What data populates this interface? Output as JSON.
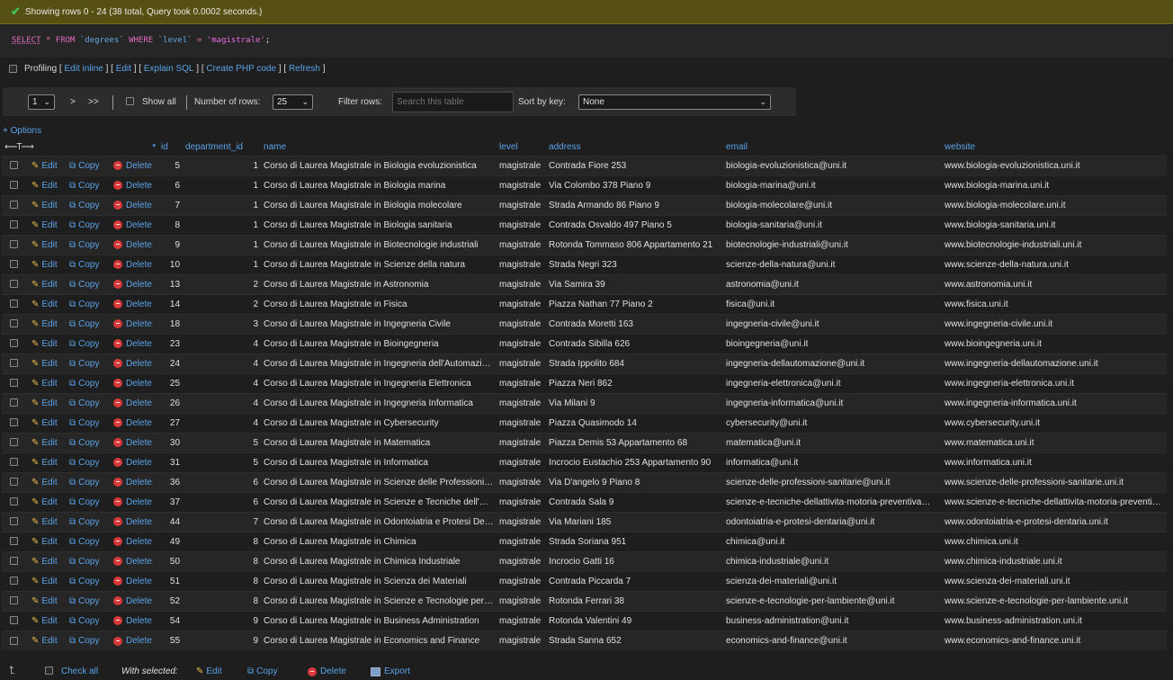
{
  "status": {
    "message": "Showing rows 0 - 24 (38 total, Query took 0.0002 seconds.)"
  },
  "query": {
    "select": "SELECT",
    "star": "*",
    "from": "FROM",
    "table": "`degrees`",
    "where": "WHERE",
    "column": "`level`",
    "eq": "=",
    "value": "'magistrale'",
    "semicolon": ";"
  },
  "query_links": {
    "profiling": "Profiling",
    "edit_inline": "Edit inline",
    "edit": "Edit",
    "explain": "Explain SQL",
    "php": "Create PHP code",
    "refresh": "Refresh"
  },
  "nav": {
    "page": "1",
    "next": ">",
    "last": ">>",
    "show_all": "Show all",
    "num_rows_label": "Number of rows:",
    "num_rows": "25",
    "filter_label": "Filter rows:",
    "filter_placeholder": "Search this table",
    "sort_label": "Sort by key:",
    "sort_value": "None"
  },
  "options_link": "+ Options",
  "columns": [
    "id",
    "department_id",
    "name",
    "level",
    "address",
    "email",
    "website"
  ],
  "actions": {
    "edit": "Edit",
    "copy": "Copy",
    "delete": "Delete"
  },
  "rows": [
    [
      "5",
      "1",
      "Corso di Laurea Magistrale in Biologia evoluzionistica",
      "magistrale",
      "Contrada Fiore 253",
      "biologia-evoluzionistica@uni.it",
      "www.biologia-evoluzionistica.uni.it"
    ],
    [
      "6",
      "1",
      "Corso di Laurea Magistrale in Biologia marina",
      "magistrale",
      "Via Colombo 378 Piano 9",
      "biologia-marina@uni.it",
      "www.biologia-marina.uni.it"
    ],
    [
      "7",
      "1",
      "Corso di Laurea Magistrale in Biologia molecolare",
      "magistrale",
      "Strada Armando 86 Piano 9",
      "biologia-molecolare@uni.it",
      "www.biologia-molecolare.uni.it"
    ],
    [
      "8",
      "1",
      "Corso di Laurea Magistrale in Biologia sanitaria",
      "magistrale",
      "Contrada Osvaldo 497 Piano 5",
      "biologia-sanitaria@uni.it",
      "www.biologia-sanitaria.uni.it"
    ],
    [
      "9",
      "1",
      "Corso di Laurea Magistrale in Biotecnologie industriali",
      "magistrale",
      "Rotonda Tommaso 806 Appartamento 21",
      "biotecnologie-industriali@uni.it",
      "www.biotecnologie-industriali.uni.it"
    ],
    [
      "10",
      "1",
      "Corso di Laurea Magistrale in Scienze della natura",
      "magistrale",
      "Strada Negri 323",
      "scienze-della-natura@uni.it",
      "www.scienze-della-natura.uni.it"
    ],
    [
      "13",
      "2",
      "Corso di Laurea Magistrale in Astronomia",
      "magistrale",
      "Via Samira 39",
      "astronomia@uni.it",
      "www.astronomia.uni.it"
    ],
    [
      "14",
      "2",
      "Corso di Laurea Magistrale in Fisica",
      "magistrale",
      "Piazza Nathan 77 Piano 2",
      "fisica@uni.it",
      "www.fisica.uni.it"
    ],
    [
      "18",
      "3",
      "Corso di Laurea Magistrale in Ingegneria Civile",
      "magistrale",
      "Contrada Moretti 163",
      "ingegneria-civile@uni.it",
      "www.ingegneria-civile.uni.it"
    ],
    [
      "23",
      "4",
      "Corso di Laurea Magistrale in Bioingegneria",
      "magistrale",
      "Contrada Sibilla 626",
      "bioingegneria@uni.it",
      "www.bioingegneria.uni.it"
    ],
    [
      "24",
      "4",
      "Corso di Laurea Magistrale in Ingegneria dell'Automazione",
      "magistrale",
      "Strada Ippolito 684",
      "ingegneria-dellautomazione@uni.it",
      "www.ingegneria-dellautomazione.uni.it"
    ],
    [
      "25",
      "4",
      "Corso di Laurea Magistrale in Ingegneria Elettronica",
      "magistrale",
      "Piazza Neri 862",
      "ingegneria-elettronica@uni.it",
      "www.ingegneria-elettronica.uni.it"
    ],
    [
      "26",
      "4",
      "Corso di Laurea Magistrale in Ingegneria Informatica",
      "magistrale",
      "Via Milani 9",
      "ingegneria-informatica@uni.it",
      "www.ingegneria-informatica.uni.it"
    ],
    [
      "27",
      "4",
      "Corso di Laurea Magistrale in Cybersecurity",
      "magistrale",
      "Piazza Quasimodo 14",
      "cybersecurity@uni.it",
      "www.cybersecurity.uni.it"
    ],
    [
      "30",
      "5",
      "Corso di Laurea Magistrale in Matematica",
      "magistrale",
      "Piazza Demis 53 Appartamento 68",
      "matematica@uni.it",
      "www.matematica.uni.it"
    ],
    [
      "31",
      "5",
      "Corso di Laurea Magistrale in Informatica",
      "magistrale",
      "Incrocio Eustachio 253 Appartamento 90",
      "informatica@uni.it",
      "www.informatica.uni.it"
    ],
    [
      "36",
      "6",
      "Corso di Laurea Magistrale in Scienze delle Professioni Sanitarie",
      "magistrale",
      "Via D'angelo 9 Piano 8",
      "scienze-delle-professioni-sanitarie@uni.it",
      "www.scienze-delle-professioni-sanitarie.uni.it"
    ],
    [
      "37",
      "6",
      "Corso di Laurea Magistrale in Scienze e Tecniche dell'Attività Motoria Preventiva",
      "magistrale",
      "Contrada Sala 9",
      "scienze-e-tecniche-dellattivita-motoria-preventiva@uni.it",
      "www.scienze-e-tecniche-dellattivita-motoria-preventiva.uni.it"
    ],
    [
      "44",
      "7",
      "Corso di Laurea Magistrale in Odontoiatria e Protesi Dentaria",
      "magistrale",
      "Via Mariani 185",
      "odontoiatria-e-protesi-dentaria@uni.it",
      "www.odontoiatria-e-protesi-dentaria.uni.it"
    ],
    [
      "49",
      "8",
      "Corso di Laurea Magistrale in Chimica",
      "magistrale",
      "Strada Soriana 951",
      "chimica@uni.it",
      "www.chimica.uni.it"
    ],
    [
      "50",
      "8",
      "Corso di Laurea Magistrale in Chimica Industriale",
      "magistrale",
      "Incrocio Gatti 16",
      "chimica-industriale@uni.it",
      "www.chimica-industriale.uni.it"
    ],
    [
      "51",
      "8",
      "Corso di Laurea Magistrale in Scienza dei Materiali",
      "magistrale",
      "Contrada Piccarda 7",
      "scienza-dei-materiali@uni.it",
      "www.scienza-dei-materiali.uni.it"
    ],
    [
      "52",
      "8",
      "Corso di Laurea Magistrale in Scienze e Tecnologie per l'Ambiente",
      "magistrale",
      "Rotonda Ferrari 38",
      "scienze-e-tecnologie-per-lambiente@uni.it",
      "www.scienze-e-tecnologie-per-lambiente.uni.it"
    ],
    [
      "54",
      "9",
      "Corso di Laurea Magistrale in Business Administration",
      "magistrale",
      "Rotonda Valentini 49",
      "business-administration@uni.it",
      "www.business-administration.uni.it"
    ],
    [
      "55",
      "9",
      "Corso di Laurea Magistrale in Economics and Finance",
      "magistrale",
      "Strada Sanna 652",
      "economics-and-finance@uni.it",
      "www.economics-and-finance.uni.it"
    ]
  ],
  "footer": {
    "check_all": "Check all",
    "with_selected": "With selected:",
    "edit": "Edit",
    "copy": "Copy",
    "delete": "Delete",
    "export": "Export"
  },
  "colors": {
    "link": "#5aa3e8",
    "success_bg": "#565012",
    "row_odd": "#262626",
    "row_even": "#1e1e1e"
  }
}
